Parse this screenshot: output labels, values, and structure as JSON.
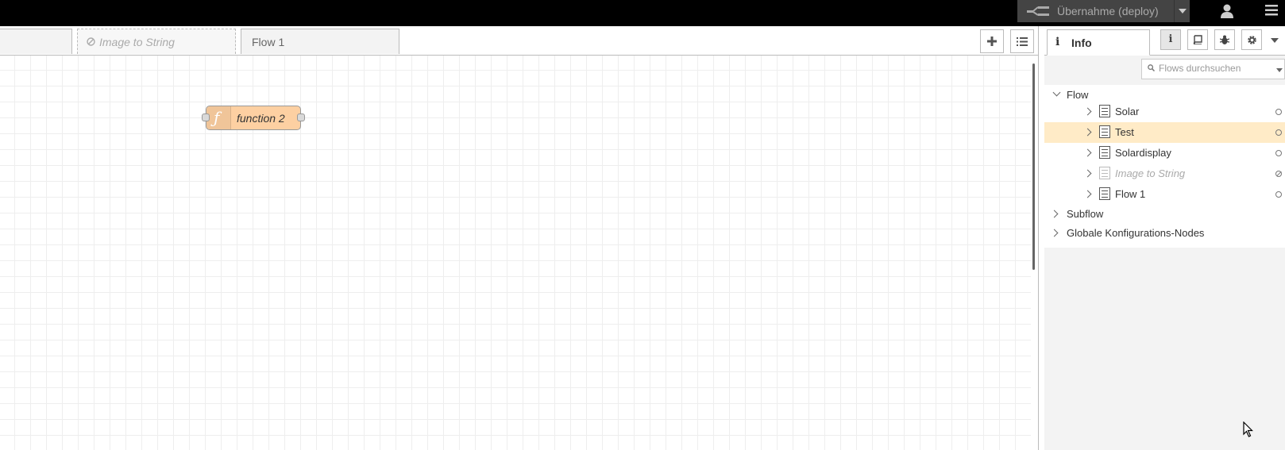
{
  "header": {
    "deploy_label": "Übernahme (deploy)",
    "deploy_icon": "deploy-icon",
    "user_icon": "user-icon",
    "menu_icon": "hamburger-menu-icon",
    "colors": {
      "header_bg": "#000000",
      "deploy_bg": "#444444"
    }
  },
  "workspace_tabs": {
    "tabs": [
      {
        "label": "",
        "state": "normal"
      },
      {
        "label": "Image to String",
        "state": "disabled",
        "icon": "ban-icon"
      },
      {
        "label": "Flow 1",
        "state": "normal"
      }
    ],
    "add_icon": "plus-icon",
    "list_icon": "list-icon"
  },
  "workspace": {
    "nodes": [
      {
        "label": "function 2",
        "type": "function",
        "icon": "function-icon",
        "color": "#fdd0a2"
      }
    ]
  },
  "sidebar": {
    "active_tab": "Info",
    "tab_buttons": [
      "info-icon",
      "book-icon",
      "bug-icon",
      "gear-icon"
    ],
    "search": {
      "placeholder": "Flows durchsuchen",
      "value": ""
    },
    "tree": {
      "flow_header": "Flow",
      "flows": [
        {
          "label": "Solar",
          "selected": false,
          "disabled": false
        },
        {
          "label": "Test",
          "selected": true,
          "disabled": false
        },
        {
          "label": "Solardisplay",
          "selected": false,
          "disabled": false
        },
        {
          "label": "Image to String",
          "selected": false,
          "disabled": true
        },
        {
          "label": "Flow 1",
          "selected": false,
          "disabled": false
        }
      ],
      "subflow_header": "Subflow",
      "config_header": "Globale Konfigurations-Nodes"
    },
    "selection_color": "#ffebc7"
  }
}
